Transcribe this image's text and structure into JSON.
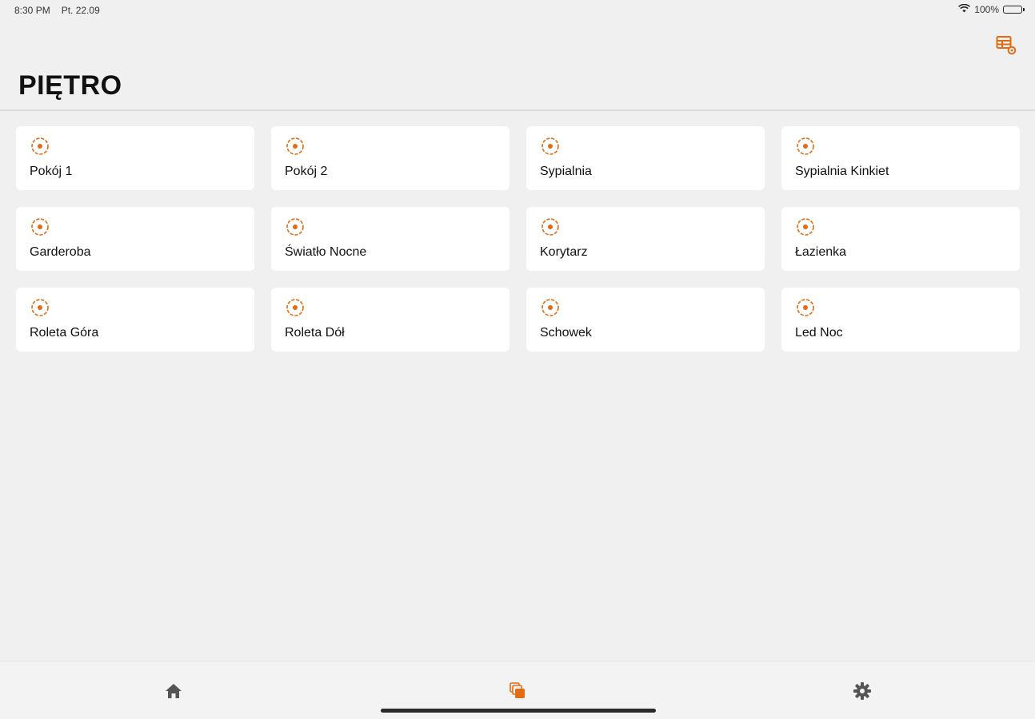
{
  "status_bar": {
    "time": "8:30 PM",
    "date": "Pt. 22.09",
    "battery_text": "100%",
    "battery_level": 1.0
  },
  "header": {
    "title": "PIĘTRO",
    "layout_icon": "grid-settings-icon"
  },
  "accent_color": "#e36b12",
  "rooms": [
    {
      "label": "Pokój 1",
      "icon": "target-icon"
    },
    {
      "label": "Pokój 2",
      "icon": "target-icon"
    },
    {
      "label": "Sypialnia",
      "icon": "target-icon"
    },
    {
      "label": "Sypialnia Kinkiet",
      "icon": "target-icon"
    },
    {
      "label": "Garderoba",
      "icon": "target-icon"
    },
    {
      "label": "Światło Nocne",
      "icon": "target-icon"
    },
    {
      "label": "Korytarz",
      "icon": "target-icon"
    },
    {
      "label": "Łazienka",
      "icon": "target-icon"
    },
    {
      "label": "Roleta Góra",
      "icon": "target-icon"
    },
    {
      "label": "Roleta Dół",
      "icon": "target-icon"
    },
    {
      "label": "Schowek",
      "icon": "target-icon"
    },
    {
      "label": "Led Noc",
      "icon": "target-icon"
    }
  ],
  "bottom_nav": {
    "items": [
      {
        "icon": "home-icon",
        "active": false
      },
      {
        "icon": "rooms-icon",
        "active": true
      },
      {
        "icon": "gear-icon",
        "active": false
      }
    ]
  }
}
